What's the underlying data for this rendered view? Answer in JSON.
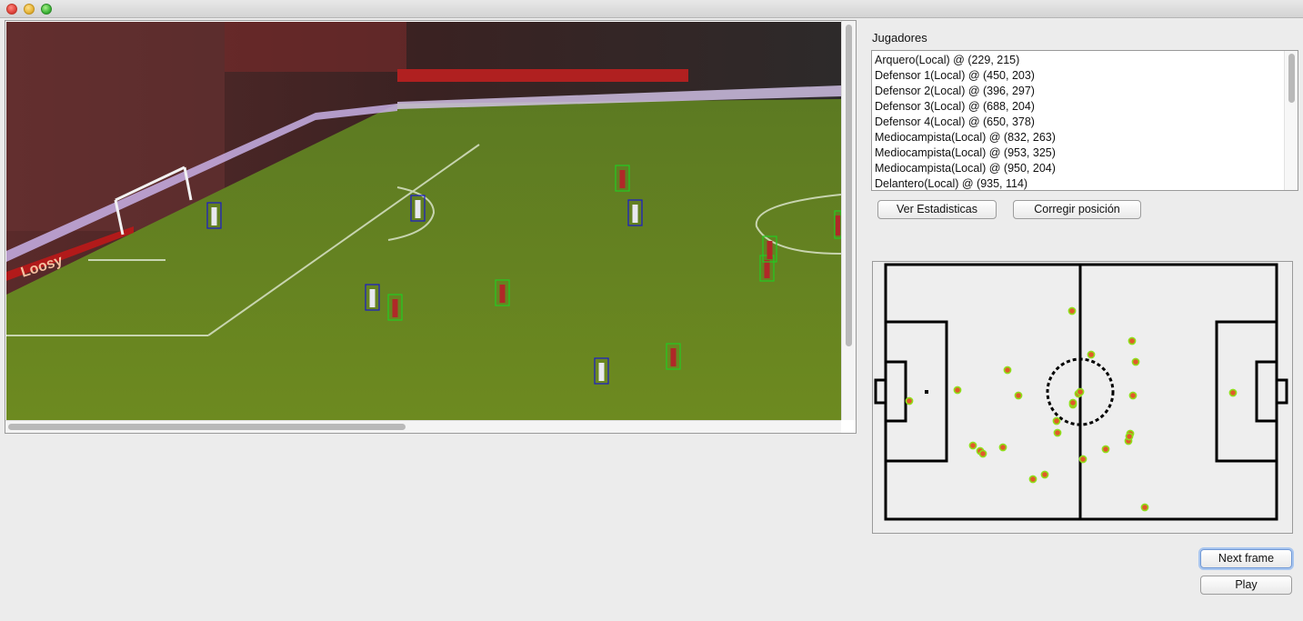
{
  "window": {
    "controls": [
      "close",
      "minimize",
      "maximize"
    ]
  },
  "players_panel": {
    "title": "Jugadores",
    "items": [
      "Arquero(Local) @ (229, 215)",
      "Defensor 1(Local) @ (450, 203)",
      "Defensor 2(Local) @ (396, 297)",
      "Defensor 3(Local) @ (688, 204)",
      "Defensor 4(Local) @ (650, 378)",
      "Mediocampista(Local) @ (832, 263)",
      "Mediocampista(Local) @ (953, 325)",
      "Mediocampista(Local) @ (950, 204)",
      "Delantero(Local) @ (935, 114)"
    ]
  },
  "buttons": {
    "stats": "Ver Estadisticas",
    "correct_position": "Corregir posición",
    "next_frame": "Next frame",
    "play": "Play"
  },
  "video": {
    "ad_board_text": "Loosy",
    "box_colors": {
      "local": "#1a1acc",
      "visitante": "#22cc22"
    },
    "boxes": [
      {
        "team": "local"
      },
      {
        "team": "local"
      },
      {
        "team": "local"
      },
      {
        "team": "local"
      },
      {
        "team": "local"
      },
      {
        "team": "visitante"
      },
      {
        "team": "visitante"
      },
      {
        "team": "visitante"
      },
      {
        "team": "visitante"
      },
      {
        "team": "visitante"
      },
      {
        "team": "visitante"
      },
      {
        "team": "visitante"
      }
    ]
  },
  "minimap": {
    "line_color": "#000000",
    "marker_fill": "#e05a2a",
    "marker_ring": "#8fe01a",
    "marker_count": 28
  }
}
